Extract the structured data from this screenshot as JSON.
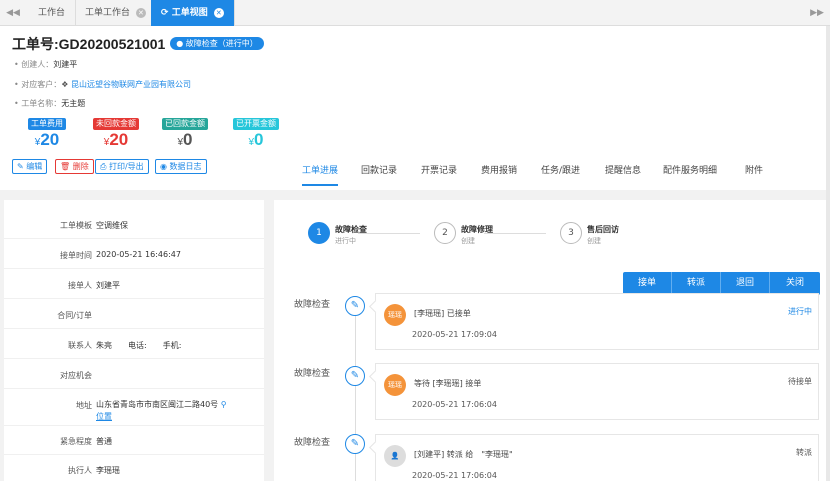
{
  "tabbar": {
    "prev": "◀◀",
    "next": "▶▶",
    "tabs": [
      {
        "label": "工作台",
        "closable": false
      },
      {
        "label": "工单工作台",
        "closable": true
      },
      {
        "label": "工单视图",
        "closable": true,
        "active": true
      }
    ],
    "refresh_icon": "refresh-icon",
    "close_glyph": "✕"
  },
  "header": {
    "title": "工单号:GD20200521001",
    "status": "故障检查（进行中）",
    "creator_label": "创建人：",
    "creator": "刘建平",
    "customer_label": "对应客户：",
    "customer": "昆山远望谷物联网产业园有限公司",
    "name_label": "工单名称：",
    "name": "无主题"
  },
  "money": [
    {
      "label": "工单费用",
      "value": "20",
      "color": "#1e88e5"
    },
    {
      "label": "未回款金额",
      "value": "20",
      "color": "#e53935"
    },
    {
      "label": "已回款金额",
      "value": "0",
      "color": "#26a69a"
    },
    {
      "label": "已开票金额",
      "value": "0",
      "color": "#26c6da"
    }
  ],
  "currency": "¥",
  "actions": {
    "edit": "编辑",
    "delete": "删除",
    "print": "打印/导出",
    "log": "数据日志"
  },
  "subtabs": [
    "工单进展",
    "回款记录",
    "开票记录",
    "费用报销",
    "任务/跟进",
    "提醒信息",
    "配件服务明细",
    "附件"
  ],
  "fields": [
    {
      "k": "工单模板",
      "v": "空调维保"
    },
    {
      "k": "接单时间",
      "v": "2020-05-21 16:46:47"
    },
    {
      "k": "接单人",
      "v": "刘建平"
    },
    {
      "k": "合同/订单",
      "v": ""
    },
    {
      "k": "联系人",
      "v": "朱亮　　电话:　　手机:"
    },
    {
      "k": "对应机会",
      "v": ""
    },
    {
      "k": "地址",
      "v": "山东省青岛市市南区闽江二路40号",
      "v2": "位置"
    },
    {
      "k": "紧急程度",
      "v": "普通"
    },
    {
      "k": "执行人",
      "v": "李瑶瑶"
    }
  ],
  "steps": [
    {
      "num": "1",
      "title": "故障检查",
      "sub": "进行中",
      "done": true
    },
    {
      "num": "2",
      "title": "故障修理",
      "sub": "创建",
      "done": false
    },
    {
      "num": "3",
      "title": "售后回访",
      "sub": "创建",
      "done": false
    }
  ],
  "op_buttons": [
    "接单",
    "转派",
    "退回",
    "关闭"
  ],
  "timeline": [
    {
      "label": "故障检查",
      "avatar": "瑶瑶",
      "text": "[李瑶瑶] 已接单",
      "time": "2020-05-21 17:09:04",
      "status": "进行中",
      "blue": true
    },
    {
      "label": "故障检查",
      "avatar": "瑶瑶",
      "text": "等待 [李瑶瑶] 接单",
      "time": "2020-05-21 17:06:04",
      "status": "待接单",
      "blue": false
    },
    {
      "label": "故障检查",
      "avatar": "",
      "text": "[刘建平] 转派 给　\"李瑶瑶\"",
      "time": "2020-05-21 17:06:04",
      "status": "转派",
      "blue": false
    }
  ]
}
